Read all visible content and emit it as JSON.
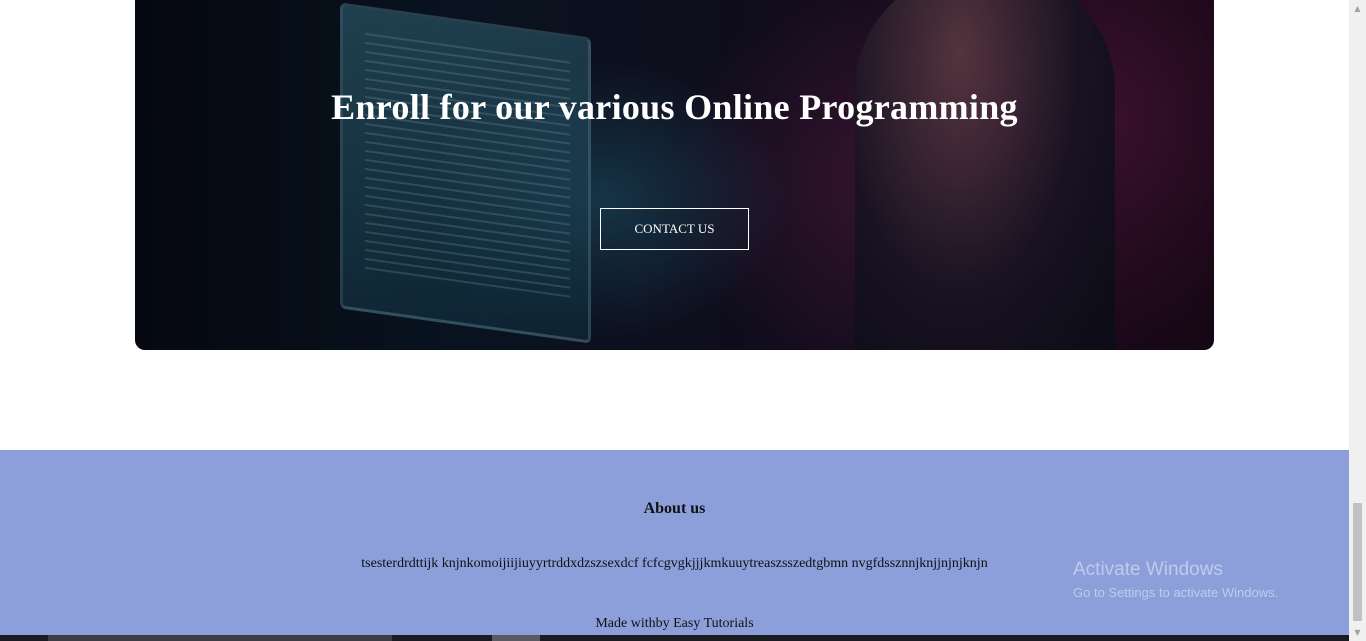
{
  "hero": {
    "title": "Enroll for our various Online Programming",
    "button_label": "CONTACT US"
  },
  "footer": {
    "heading": "About us",
    "text": "tsesterdrdttijk knjnkomoijiijiuyyrtrddxdzszsexdcf fcfcgvgkjjjkmkuuytreaszsszedtgbmn nvgfdssznnjknjjnjnjknjn",
    "credit": "Made withby Easy Tutorials"
  },
  "watermark": {
    "title": "Activate Windows",
    "subtitle": "Go to Settings to activate Windows."
  },
  "colors": {
    "footer_bg": "#8c9fdb",
    "hero_text": "#ffffff"
  },
  "icons": {
    "scroll_up": "scroll-up-arrow-icon",
    "scroll_down": "scroll-down-arrow-icon"
  }
}
